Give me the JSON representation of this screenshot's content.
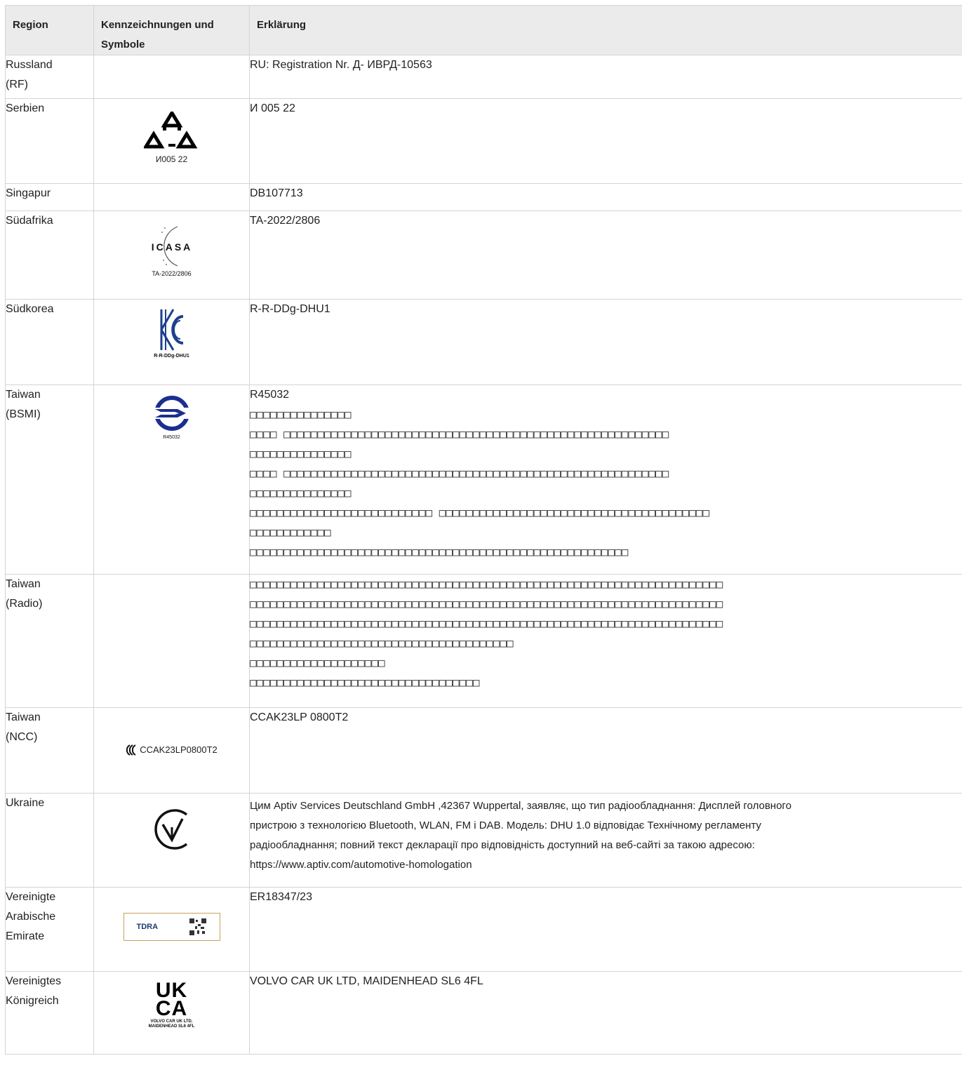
{
  "header": {
    "region": "Region",
    "symbols_line1": "Kennzeichnungen und",
    "symbols_line2": "Symbole",
    "explanation": "Erklärung"
  },
  "rows": {
    "russia": {
      "region": [
        "Russland",
        "(RF)"
      ],
      "explanation": "RU: Registration Nr. Д- ИВРД-10563"
    },
    "serbia": {
      "region": [
        "Serbien"
      ],
      "symbol_text": "И005 22",
      "explanation": "И 005 22"
    },
    "singapore": {
      "region": [
        "Singapur"
      ],
      "explanation": "DB107713"
    },
    "south_africa": {
      "region": [
        "Südafrika"
      ],
      "symbol_text": "TA-2022/2806",
      "logo_text": "ICASA",
      "explanation": "TA-2022/2806"
    },
    "south_korea": {
      "region": [
        "Südkorea"
      ],
      "symbol_text": "R-R-DDg-DHU1",
      "explanation": "R-R-DDg-DHU1"
    },
    "taiwan_bsmi": {
      "region": [
        "Taiwan",
        "(BSMI)"
      ],
      "symbol_text": "R45032",
      "explanation": [
        "R45032",
        "□□□□□□□□□□□□□□□",
        "□□□□    □□□□□□□□□□□□□□□□□□□□□□□□□□□□□□□□□□□□□□□□□□□□□□□□□□□□□□□□□",
        "□□□□□□□□□□□□□□□",
        "□□□□    □□□□□□□□□□□□□□□□□□□□□□□□□□□□□□□□□□□□□□□□□□□□□□□□□□□□□□□□□",
        "□□□□□□□□□□□□□□□",
        "□□□□□□□□□□□□□□□□□□□□□□□□□□□ □□□□□□□□□□□□□□□□□□□□□□□□□□□□□□□□□□□□□□□□",
        "□□□□□□□□□□□□",
        "□□□□□□□□□□□□□□□□□□□□□□□□□□□□□□□□□□□□□□□□□□□□□□□□□□□□□□□□"
      ]
    },
    "taiwan_radio": {
      "region": [
        "Taiwan",
        "(Radio)"
      ],
      "explanation": [
        "□□□□□□□□□□□□□□□□□□□□□□□□□□□□□□□□□□□□□□□□□□□□□□□□□□□□□□□□□□□□□□□□□□□□□□",
        "□□□□□□□□□□□□□□□□□□□□□□□□□□□□□□□□□□□□□□□□□□□□□□□□□□□□□□□□□□□□□□□□□□□□□□",
        "□□□□□□□□□□□□□□□□□□□□□□□□□□□□□□□□□□□□□□□□□□□□□□□□□□□□□□□□□□□□□□□□□□□□□□",
        "□□□□□□□□□□□□□□□□□□□□□□□□□□□□□□□□□□□□□□□",
        "□□□□□□□□□□□□□□□□□□□□",
        "□□□□□□□□□□□□□□□□□□□□□□□□□□□□□□□□□□"
      ]
    },
    "taiwan_ncc": {
      "region": [
        "Taiwan",
        "(NCC)"
      ],
      "symbol_text": "CCAK23LP0800T2",
      "explanation": "CCAK23LP 0800T2"
    },
    "ukraine": {
      "region": [
        "Ukraine"
      ],
      "explanation": [
        "Цим Aptiv Services Deutschland GmbH ,42367 Wuppertal, заявляє, що тип радіообладнання: Дисплей головного",
        "пристрою з технологією Bluetooth, WLAN, FM і DAB. Модель: DHU 1.0 відповідає Технічному регламенту",
        "радіообладнання; повний текст декларації про відповідність доступний на веб-сайті за такою адресою:",
        "https://www.aptiv.com/automotive-homologation"
      ]
    },
    "uae": {
      "region": [
        "Vereinigte",
        "Arabische",
        "Emirate"
      ],
      "logo_text": "TDRA",
      "explanation": "ER18347/23"
    },
    "uk": {
      "region": [
        "Vereinigtes",
        "Königreich"
      ],
      "logo_text": [
        "UK",
        "CA"
      ],
      "symbol_text": [
        "VOLVO CAR UK LTD.",
        "MAIDENHEAD SL6 4FL"
      ],
      "explanation": "VOLVO CAR UK LTD, MAIDENHEAD SL6 4FL"
    }
  },
  "colors": {
    "header_bg": "#ebebeb",
    "border": "#d4d4d4",
    "korea_blue": "#1d3f8f",
    "bsmi_blue": "#1b2f8f"
  }
}
